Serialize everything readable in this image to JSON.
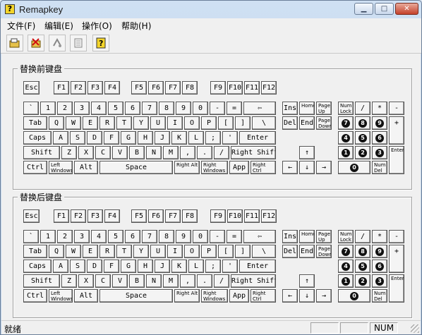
{
  "window": {
    "title": "Remapkey",
    "icon_glyph": "?"
  },
  "menu": [
    "文件(F)",
    "编辑(E)",
    "操作(O)",
    "帮助(H)"
  ],
  "toolbar": [
    "open-icon",
    "delete-icon",
    "undo-icon",
    "document-icon",
    "help-icon"
  ],
  "groups": [
    {
      "title": "替换前键盘"
    },
    {
      "title": "替换后键盘"
    }
  ],
  "keys": {
    "esc": "Esc",
    "f": [
      "F1",
      "F2",
      "F3",
      "F4",
      "F5",
      "F6",
      "F7",
      "F8",
      "F9",
      "F10",
      "F11",
      "F12"
    ],
    "row1": [
      "`",
      "1",
      "2",
      "3",
      "4",
      "5",
      "6",
      "7",
      "8",
      "9",
      "0",
      "-",
      "=",
      "⇦"
    ],
    "row2": [
      "Tab",
      "Q",
      "W",
      "E",
      "R",
      "T",
      "Y",
      "U",
      "I",
      "O",
      "P",
      "[",
      "]",
      "\\"
    ],
    "row3": [
      "Caps",
      "A",
      "S",
      "D",
      "F",
      "G",
      "H",
      "J",
      "K",
      "L",
      ";",
      "'",
      "Enter"
    ],
    "row4": [
      "Shift",
      "Z",
      "X",
      "C",
      "V",
      "B",
      "N",
      "M",
      ",",
      ".",
      "/",
      "Right Shift"
    ],
    "row5": [
      "Ctrl",
      "Left Windows",
      "Alt",
      "Space",
      "Right Alt",
      "Right Windows",
      "App",
      "Right Ctrl"
    ],
    "nav": [
      "Ins",
      "Home",
      "Page Up",
      "Del",
      "End",
      "Page Down"
    ],
    "arrows": [
      "↑",
      "←",
      "↓",
      "→"
    ],
    "num": [
      "Num Lock",
      "/",
      "*",
      "-",
      "7",
      "8",
      "9",
      "+",
      "4",
      "5",
      "6",
      "1",
      "2",
      "3",
      "Enter",
      "0",
      "Num Del"
    ]
  },
  "status": {
    "text": "就绪",
    "num": "NUM"
  }
}
